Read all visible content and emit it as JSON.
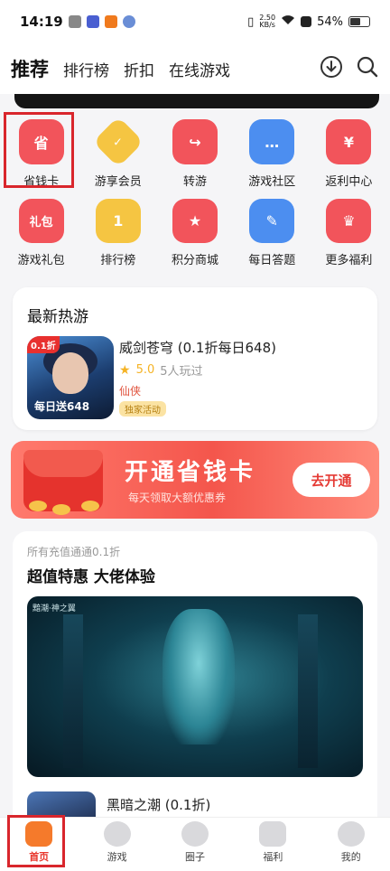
{
  "status_bar": {
    "time": "14:19",
    "net_speed_value": "2.50",
    "net_speed_unit": "KB/s",
    "battery": "54%"
  },
  "header": {
    "tabs": [
      {
        "label": "推荐",
        "active": true
      },
      {
        "label": "排行榜",
        "active": false
      },
      {
        "label": "折扣",
        "active": false
      },
      {
        "label": "在线游戏",
        "active": false
      }
    ],
    "icons": [
      "download-icon",
      "search-icon"
    ]
  },
  "quick_grid": {
    "row1": [
      {
        "label": "省钱卡",
        "icon": "savings-card-icon",
        "icon_text": "省",
        "color": "#f2545b",
        "highlighted": true
      },
      {
        "label": "游享会员",
        "icon": "vip-member-icon",
        "icon_text": "✓",
        "color": "#f5c542"
      },
      {
        "label": "转游",
        "icon": "transfer-game-icon",
        "icon_text": "↪",
        "color": "#f2545b"
      },
      {
        "label": "游戏社区",
        "icon": "community-icon",
        "icon_text": "…",
        "color": "#4c8ef0"
      },
      {
        "label": "返利中心",
        "icon": "rebate-center-icon",
        "icon_text": "¥",
        "color": "#f2545b"
      }
    ],
    "row2": [
      {
        "label": "游戏礼包",
        "icon": "gift-pack-icon",
        "icon_text": "礼包",
        "color": "#f2545b"
      },
      {
        "label": "排行榜",
        "icon": "ranking-icon",
        "icon_text": "1",
        "color": "#f5c542"
      },
      {
        "label": "积分商城",
        "icon": "points-mall-icon",
        "icon_text": "★",
        "color": "#f2545b"
      },
      {
        "label": "每日答题",
        "icon": "daily-quiz-icon",
        "icon_text": "✎",
        "color": "#4c8ef0"
      },
      {
        "label": "更多福利",
        "icon": "more-benefits-icon",
        "icon_text": "♛",
        "color": "#f2545b"
      }
    ]
  },
  "hot_games": {
    "title": "最新热游",
    "game": {
      "name": "威剑苍穹 (0.1折每日648)",
      "rating": "5.0",
      "players": "5人玩过",
      "genre": "仙侠",
      "tag": "独家活动",
      "thumb_badge": "0.1折",
      "thumb_text": "每日送648"
    }
  },
  "save_banner": {
    "title": "开通省钱卡",
    "subtitle": "每天领取大额优惠券",
    "button": "去开通"
  },
  "promo": {
    "small_text": "所有充值通通0.1折",
    "title": "超值特惠 大佬体验",
    "image_caption": "黯潮·神之翼",
    "next_game": "黑暗之潮 (0.1折)"
  },
  "bottom_nav": [
    {
      "label": "首页",
      "icon": "home-icon",
      "active": true
    },
    {
      "label": "游戏",
      "icon": "games-icon",
      "active": false
    },
    {
      "label": "圈子",
      "icon": "circle-icon",
      "active": false
    },
    {
      "label": "福利",
      "icon": "benefits-icon",
      "active": false
    },
    {
      "label": "我的",
      "icon": "profile-icon",
      "active": false
    }
  ]
}
